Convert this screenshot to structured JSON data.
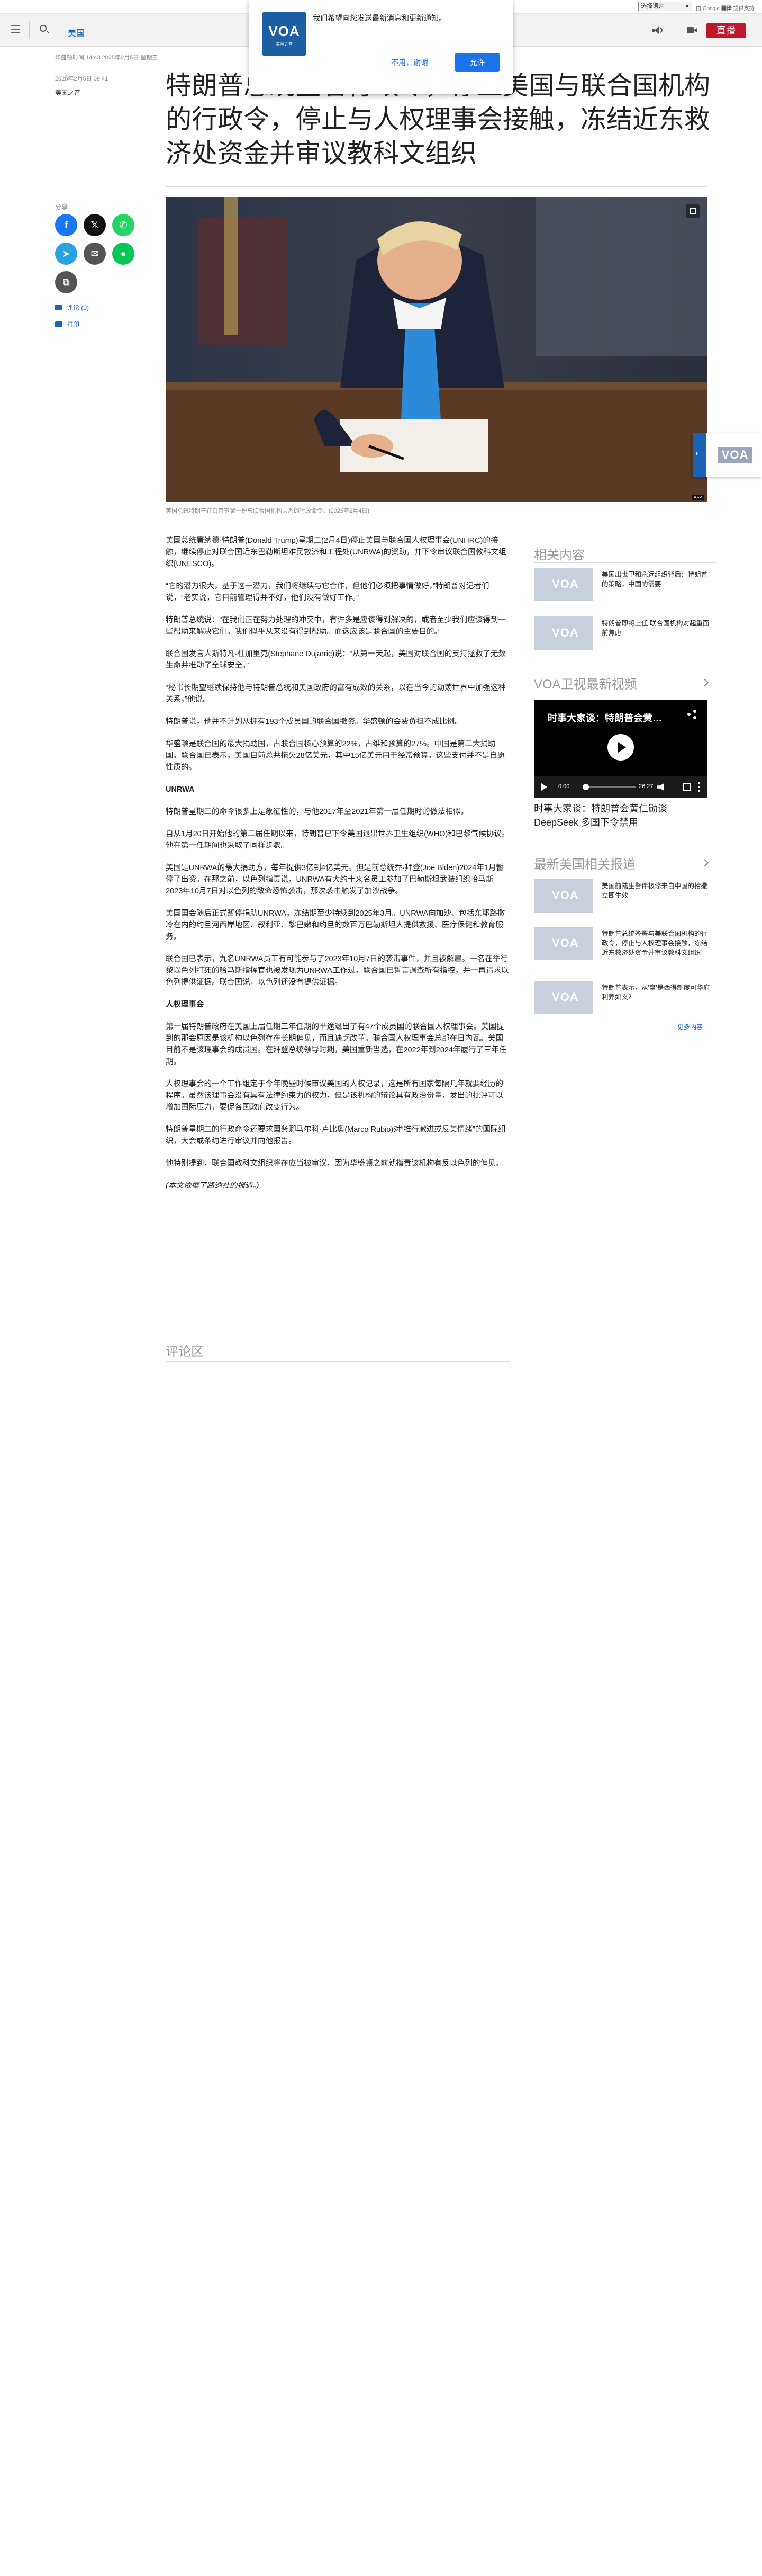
{
  "translate": {
    "select_label": "选择语言",
    "powered_prefix": "由",
    "powered_brand": "Google",
    "powered_suffix": "翻译",
    "powered_tail": "提供支持"
  },
  "header": {
    "section_label": "美国",
    "live_label": "直播"
  },
  "notification": {
    "logo_text": "VOA",
    "logo_sub": "美国之音",
    "message": "我们希望向您发送最新消息和更新通知。",
    "decline_label": "不用，谢谢",
    "accept_label": "允许"
  },
  "article": {
    "dateline": "华盛顿时间 14:43 2025年2月5日 星期三",
    "published": "2025年2月5日 09:41",
    "author": "美国之音",
    "headline": "特朗普总统签署行政令，停止美国与联合国机构的行政令，停止与人权理事会接触，冻结近东救济处资金并审议教科文组织",
    "caption": "美国总统特朗普在白宫签署一份与联合国机构关系的行政命令。(2025年2月4日)",
    "paragraphs": [
      {
        "type": "p",
        "text": "美国总统唐纳德·特朗普(Donald Trump)星期二(2月4日)停止美国与联合国人权理事会(UNHRC)的接触，继续停止对联合国近东巴勒斯坦难民救济和工程处(UNRWA)的资助，并下令审议联合国教科文组织(UNESCO)。"
      },
      {
        "type": "p",
        "text": "“它的潜力很大，基于这一潜力，我们将继续与它合作，但他们必须把事情做好，”特朗普对记者们说，“老实说，它目前管理得并不好，他们没有做好工作。”"
      },
      {
        "type": "p",
        "text": "特朗普总统说：“在我们正在努力处理的冲突中，有许多是应该得到解决的，或者至少我们应该得到一些帮助来解决它们。我们似乎从来没有得到帮助。而这应该是联合国的主要目的。”"
      },
      {
        "type": "p",
        "text": "联合国发言人斯特凡·杜加里克(Stephane Dujarric)说：“从第一天起，美国对联合国的支持拯救了无数生命并推动了全球安全。”"
      },
      {
        "type": "p",
        "text": "“秘书长期望继续保持他与特朗普总统和美国政府的富有成效的关系，以在当今的动荡世界中加强这种关系，”他说。"
      },
      {
        "type": "p",
        "text": "特朗普说，他并不计划从拥有193个成员国的联合国撤资。华盛顿的会费负担不成比例。"
      },
      {
        "type": "p",
        "text": "华盛顿是联合国的最大捐助国，占联合国核心预算的22%，占维和预算的27%。中国是第二大捐助国。联合国已表示，美国目前总共拖欠28亿美元，其中15亿美元用于经常预算。这些支付并不是自愿性质的。"
      },
      {
        "type": "sub",
        "text": "UNRWA"
      },
      {
        "type": "p",
        "text": "特朗普星期二的命令很多上是象征性的，与他2017年至2021年第一届任期时的做法相似。"
      },
      {
        "type": "p",
        "text": "自从1月20日开始他的第二届任期以来，特朗普已下令美国退出世界卫生组织(WHO)和巴黎气候协议。他在第一任期间也采取了同样步骤。"
      },
      {
        "type": "p",
        "text": "美国是UNRWA的最大捐助方，每年提供3亿到4亿美元。但是前总统乔·拜登(Joe Biden)2024年1月暂停了出资。在那之前，以色列指责说，UNRWA有大约十来名员工参加了巴勒斯坦武装组织哈马斯2023年10月7日对以色列的致命恐怖袭击，那次袭击触发了加沙战争。"
      },
      {
        "type": "p",
        "text": "美国国会随后正式暂停捐助UNRWA，冻结期至少持续到2025年3月。UNRWA向加沙、包括东耶路撒冷在内的约旦河西岸地区、叙利亚、黎巴嫩和约旦的数百万巴勒斯坦人提供救援、医疗保健和教育服务。"
      },
      {
        "type": "p",
        "text": "联合国已表示，九名UNRWA员工有可能参与了2023年10月7日的袭击事件，并且被解雇。一名在举行黎以色列打死的哈马斯指挥官也被发现为UNRWA工作过。联合国已誓言调查所有指控，并一再请求以色列提供证据。联合国说，以色列还没有提供证据。"
      },
      {
        "type": "sub",
        "text": "人权理事会"
      },
      {
        "type": "p",
        "text": "第一届特朗普政府在美国上届任期三年任期的半途退出了有47个成员国的联合国人权理事会。美国提到的那会原因是该机构以色列存在长期偏见，而且缺乏改革。联合国人权理事会总部在日内瓦。美国目前不是该理事会的成员国。在拜登总统领导时期，美国重新当选，在2022年到2024年履行了三年任期。"
      },
      {
        "type": "p",
        "text": "人权理事会的一个工作组定于今年晚些时候审议美国的人权记录，这是所有国家每隔几年就要经历的程序。虽然该理事会没有具有法律约束力的权力，但是该机构的辩论具有政治份量，发出的批评可以增加国际压力，要促各国政府改变行为。"
      },
      {
        "type": "p",
        "text": "特朗普星期二的行政命令还要求国务卿马尔科·卢比奥(Marco Rubio)对“推行激进或反美情绪”的国际组织，大会或条约进行审议并向他报告。"
      },
      {
        "type": "p",
        "text": "他特别提到，联合国教科文组织将在应当被审议，因为华盛顿之前就指责该机构有反以色列的偏见。"
      },
      {
        "type": "note",
        "text": "(本文依据了路透社的报道。)"
      }
    ],
    "comments_heading": "评论区"
  },
  "share": {
    "label": "分享",
    "comment_link": "评论 (0)",
    "print_link": "打印"
  },
  "sidebar": {
    "related_title": "相关内容",
    "related": [
      {
        "text": "美国出世卫和永远组织背后：特朗普的策略，中国的需要"
      },
      {
        "text": "特朗普即将上任 联合国机构对起重面前焦虑"
      }
    ],
    "video_title_heading": "VOA卫视最新视频",
    "video": {
      "overlay_title": "时事大家谈：特朗普会黄…",
      "time_current": "0:00",
      "time_total": "26:27",
      "caption": "时事大家谈：特朗普会黄仁勋谈 DeepSeek 多国下令禁用"
    },
    "latest_title": "最新美国相关报道",
    "latest": [
      {
        "text": "美国前陆生警伴极修来自中国的拾撒 立即生效"
      },
      {
        "text": "特朗普总统签署与美联合国机构的行政令，停止与人权理事会接触，冻结近东救济处资金并审议教科文组织"
      },
      {
        "text": "特朗普表示，从'拿'是西得制度可华府利弊如义？"
      }
    ],
    "more_label": "更多内容"
  },
  "float_tab": {
    "logo_text": "VOA"
  },
  "colors": {
    "brand_blue": "#1a63b5",
    "live_red": "#c0172a",
    "accept_blue": "#1a73e8"
  }
}
